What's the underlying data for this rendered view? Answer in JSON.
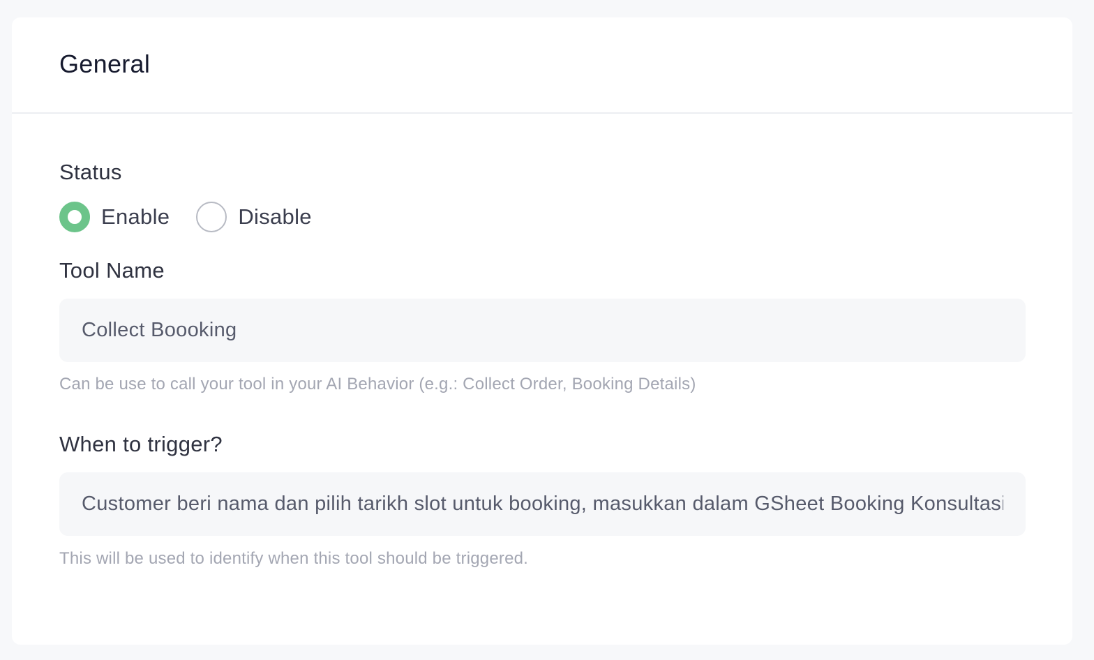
{
  "section": {
    "title": "General"
  },
  "status": {
    "label": "Status",
    "options": [
      {
        "label": "Enable",
        "checked": true
      },
      {
        "label": "Disable",
        "checked": false
      }
    ]
  },
  "tool_name": {
    "label": "Tool Name",
    "value": "Collect Boooking",
    "help": "Can be use to call your tool in your AI Behavior (e.g.: Collect Order, Booking Details)"
  },
  "trigger": {
    "label": "When to trigger?",
    "value": "Customer beri nama dan pilih tarikh slot untuk booking, masukkan dalam GSheet Booking Konsultasi",
    "help": "This will be used to identify when this tool should be triggered."
  },
  "colors": {
    "accent": "#6cc48a",
    "input_bg": "#f6f7f9",
    "help_text": "#a3a6b2"
  }
}
